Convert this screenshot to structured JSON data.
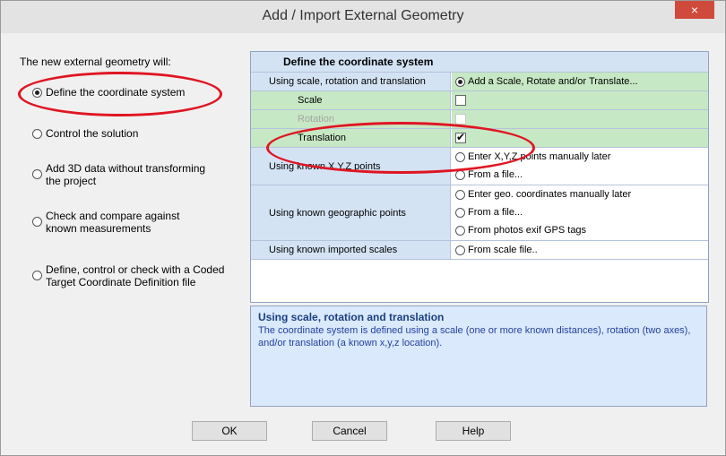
{
  "window": {
    "title": "Add / Import External Geometry",
    "close_glyph": "×"
  },
  "left": {
    "intro": "The new external geometry will:",
    "options": [
      {
        "label": "Define the coordinate system",
        "selected": true
      },
      {
        "label": "Control the solution",
        "selected": false
      },
      {
        "label": "Add 3D data without transforming the project",
        "selected": false
      },
      {
        "label": "Check and compare against known measurements",
        "selected": false
      },
      {
        "label": "Define, control or check with a Coded Target Coordinate Definition file",
        "selected": false
      }
    ]
  },
  "grid": {
    "header": "Define the coordinate system",
    "rows": {
      "scale_rot_trans": {
        "label": "Using scale, rotation and translation",
        "option": "Add a Scale, Rotate and/or Translate..."
      },
      "scale": {
        "label": "Scale",
        "checked": false
      },
      "rotation": {
        "label": "Rotation",
        "checked": false,
        "disabled": true
      },
      "translation": {
        "label": "Translation",
        "checked": true
      },
      "xyz": {
        "label": "Using known X,Y,Z points",
        "options": [
          "Enter X,Y,Z points manually later",
          "From a file..."
        ]
      },
      "geo": {
        "label": "Using known geographic points",
        "options": [
          "Enter geo. coordinates manually later",
          "From a file...",
          "From photos exif GPS tags"
        ]
      },
      "imported": {
        "label": "Using known imported scales",
        "options": [
          "From scale file.."
        ]
      }
    }
  },
  "description": {
    "title": "Using scale, rotation and translation",
    "text": "The coordinate system is defined using a scale (one or more known distances), rotation (two axes), and/or translation (a known x,y,z location)."
  },
  "buttons": {
    "ok": "OK",
    "cancel": "Cancel",
    "help": "Help"
  },
  "colors": {
    "highlight_green": "#c7e8c4",
    "header_blue": "#d4e3f4",
    "annotation_red": "#e01522",
    "desc_title": "#1b3f82"
  }
}
